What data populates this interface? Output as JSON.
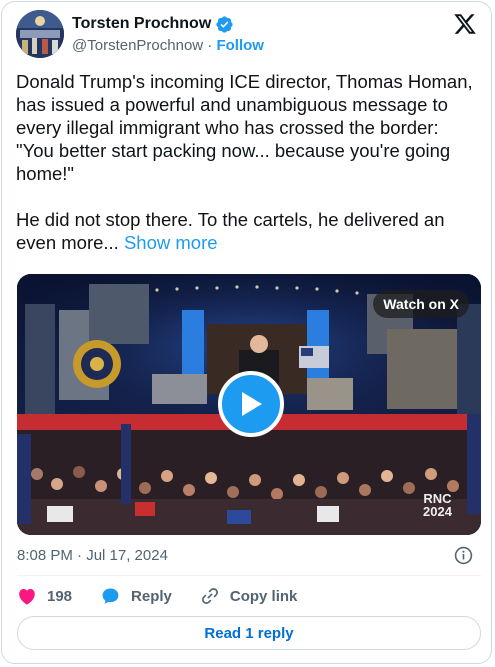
{
  "author": {
    "name": "Torsten Prochnow",
    "handle": "@TorstenProchnow",
    "separator": "·",
    "follow_label": "Follow"
  },
  "tweet": {
    "paragraph_1": "Donald Trump's incoming ICE director, Thomas Homan, has issued a powerful and unambiguous message to every illegal immigrant who has crossed the border: \"You better start packing now... because you're going home!\"",
    "paragraph_2": "He did not stop there. To the cartels, he delivered an even more...",
    "show_more_label": "Show more"
  },
  "media": {
    "watch_label": "Watch on X",
    "overlay_rnc": "RNC",
    "overlay_year": "2024"
  },
  "meta": {
    "timestamp": "8:08 PM · Jul 17, 2024"
  },
  "actions": {
    "likes_count": "198",
    "reply_label": "Reply",
    "copy_link_label": "Copy link"
  },
  "footer": {
    "read_replies_label": "Read 1 reply"
  },
  "colors": {
    "accent": "#1d9bf0",
    "like": "#f91880",
    "secondary_text": "#536471",
    "border": "#cfd9de"
  },
  "icons": [
    "verified-badge-icon",
    "x-logo-icon",
    "play-icon",
    "info-icon",
    "heart-icon",
    "reply-bubble-icon",
    "link-icon"
  ]
}
